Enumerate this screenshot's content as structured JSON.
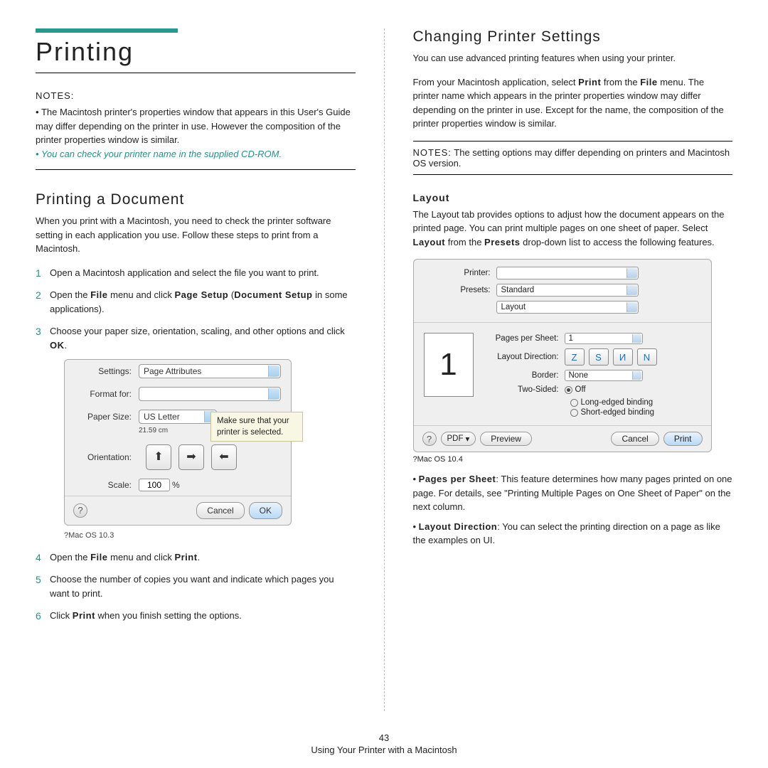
{
  "left": {
    "title": "Printing",
    "notes_head": "NOTES:",
    "notes": [
      "The Macintosh printer's properties window that appears in this User's Guide may differ depending on the printer in use. However the composition of the printer properties window is similar.",
      "You can check your printer name in the supplied CD-ROM."
    ],
    "sub_title": "Printing a Document",
    "intro": "When you print with a Macintosh, you need to check the printer software setting in each application you use. Follow these steps to print from a Macintosh.",
    "steps": [
      "Open a Macintosh application and select the file you want to print.",
      "Open the File menu and click Page Setup (Document Setup in some applications).",
      "Choose your paper size, orientation, scaling, and other options and click OK.",
      "Open the File menu and click Print.",
      "Choose the number of copies you want and indicate which pages you want to print.",
      "Click Print when you finish setting the options."
    ],
    "step2_bold1": "File",
    "step2_bold2": "Page Setup",
    "step2_paren": "Document Setup",
    "step3_bold": "OK",
    "step4_bold1": "File",
    "step4_bold2": "Print",
    "step6_bold": "Print",
    "dlg": {
      "settings_label": "Settings:",
      "settings_value": "Page Attributes",
      "format_label": "Format for:",
      "format_value": "",
      "paper_label": "Paper Size:",
      "paper_value": "US Letter",
      "paper_sub": "21.59 cm",
      "orient_label": "Orientation:",
      "scale_label": "Scale:",
      "scale_value": "100",
      "scale_unit": "%",
      "cancel": "Cancel",
      "ok": "OK",
      "callout": "Make sure that your printer is selected."
    },
    "caption": "?Mac OS 10.3"
  },
  "right": {
    "title": "Changing Printer Settings",
    "p1": "You can use advanced printing features when using your printer.",
    "p2": "From your Macintosh application, select Print from the File menu. The printer name which appears in the printer properties window may differ depending on the printer in use. Except for the name, the composition of the printer properties window is similar.",
    "p2_bold1": "Print",
    "p2_bold2": "File",
    "note_label": "NOTES:",
    "note_text": "The setting options may differ depending on printers and Macintosh OS version.",
    "layout_head": "Layout",
    "layout_p": "The Layout tab provides options to adjust how the document appears on the printed page. You can print multiple pages on one sheet of paper. Select Layout from the Presets drop-down list to access the following features.",
    "layout_bold1": "Layout",
    "layout_bold2": "Presets",
    "dlg2": {
      "printer_label": "Printer:",
      "printer_value": "",
      "presets_label": "Presets:",
      "presets_value": "Standard",
      "section_value": "Layout",
      "pps_label": "Pages per Sheet:",
      "pps_value": "1",
      "dir_label": "Layout Direction:",
      "border_label": "Border:",
      "border_value": "None",
      "twosided_label": "Two-Sided:",
      "two_off": "Off",
      "two_long": "Long-edged binding",
      "two_short": "Short-edged binding",
      "pdf": "PDF",
      "preview": "Preview",
      "cancel": "Cancel",
      "print": "Print",
      "preview_num": "1"
    },
    "cap2": "?Mac OS 10.4",
    "feats": [
      {
        "head": "Pages per Sheet",
        "text": ": This feature determines how many pages printed on one page. For details, see \"Printing Multiple Pages on One Sheet of Paper\" on the next column."
      },
      {
        "head": "Layout Direction",
        "text": ": You can select the printing direction on a page as like the examples on UI."
      }
    ]
  },
  "footer": {
    "page": "43",
    "line": "Using Your Printer with a Macintosh"
  }
}
